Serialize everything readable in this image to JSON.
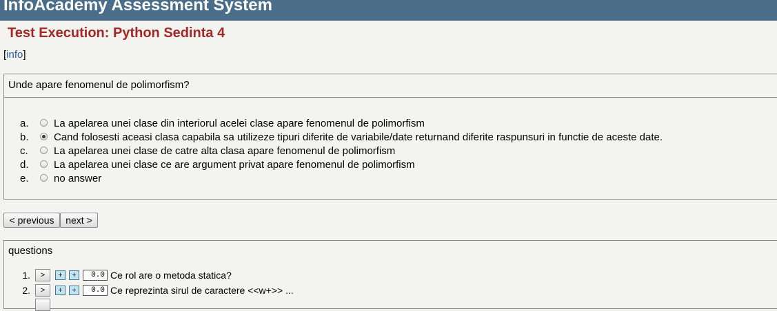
{
  "header": {
    "app_title": "InfoAcademy Assessment System"
  },
  "page": {
    "title": "Test Execution: Python Sedinta 4",
    "info_open": "[",
    "info_link": "info",
    "info_close": "]"
  },
  "question": {
    "text": "Unde apare fenomenul de polimorfism?",
    "selected": "b",
    "answers": [
      {
        "letter": "a.",
        "text": "La apelarea unei clase din interiorul acelei clase apare fenomenul de polimorfism"
      },
      {
        "letter": "b.",
        "text": "Cand folosesti aceasi clasa capabila sa utilizeze tipuri diferite de variabile/date returnand diferite raspunsuri in functie de aceste date."
      },
      {
        "letter": "c.",
        "text": "La apelarea unei clase de catre alta clasa apare fenomenul de polimorfism"
      },
      {
        "letter": "d.",
        "text": "La apelarea unei clase ce are argument privat apare fenomenul de polimorfism"
      },
      {
        "letter": "e.",
        "text": "no answer"
      }
    ]
  },
  "nav": {
    "previous_label": "< previous",
    "next_label": "next >"
  },
  "questions_panel": {
    "title": "questions",
    "go_label": ">",
    "plus_label": "+",
    "items": [
      {
        "num": "1.",
        "score": "0.0",
        "title": "Ce rol are o metoda statica?"
      },
      {
        "num": "2.",
        "score": "0.0",
        "title": "Ce reprezinta sirul de caractere <<w+>> ..."
      }
    ]
  }
}
